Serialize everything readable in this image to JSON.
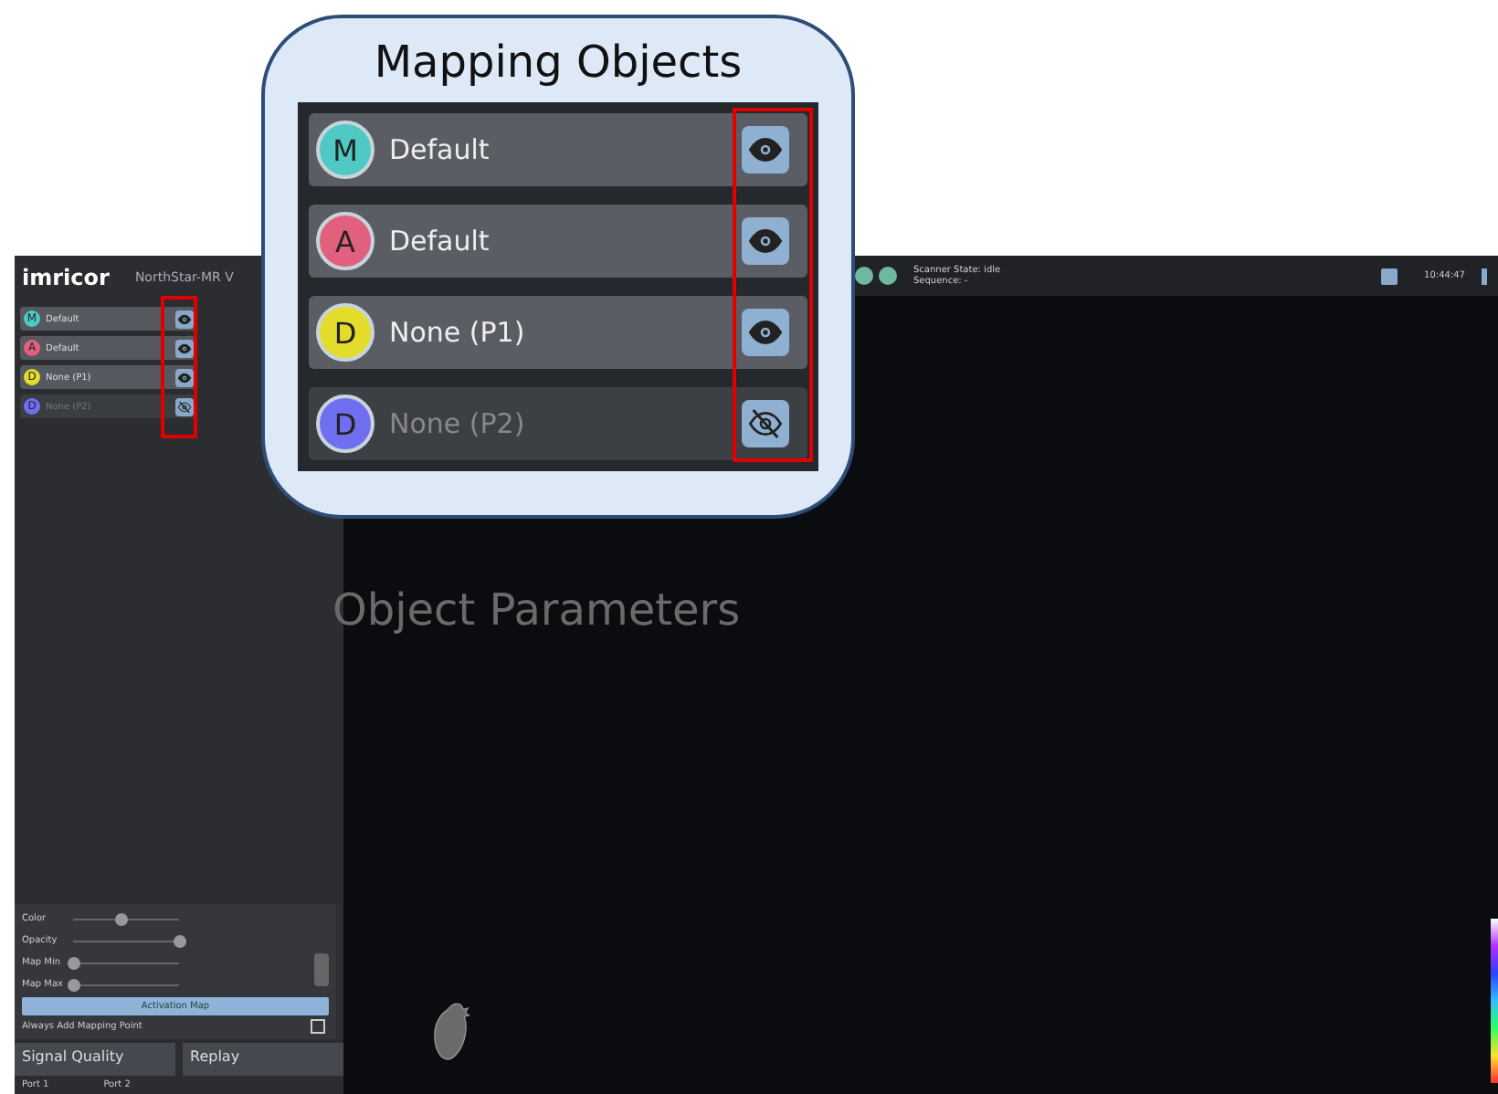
{
  "app": {
    "logo": "imricor",
    "product": "NorthStar-MR V"
  },
  "mapping_objects": [
    {
      "letter": "M",
      "color": "#4fc9c4",
      "label": "Default",
      "visible": true
    },
    {
      "letter": "A",
      "color": "#e0607e",
      "label": "Default",
      "visible": true
    },
    {
      "letter": "D",
      "color": "#e4dc2a",
      "label": "None (P1)",
      "visible": true
    },
    {
      "letter": "D",
      "color": "#6f6ff0",
      "label": "None (P2)",
      "visible": false
    }
  ],
  "object_parameters": {
    "sliders": [
      {
        "label": "Color",
        "level": 0.45
      },
      {
        "label": "Opacity",
        "level": 1.0
      },
      {
        "label": "Map Min",
        "level": 0.0
      },
      {
        "label": "Map Max",
        "level": 0.0
      }
    ],
    "button": "Activation Map",
    "option": {
      "label": "Always Add Mapping Point",
      "checked": false
    }
  },
  "bottom_tabs": [
    {
      "label": "Signal Quality"
    },
    {
      "label": "Replay"
    }
  ],
  "ports": [
    "Port 1",
    "Port 2"
  ],
  "status": {
    "state": "Scanner State: idle",
    "sequence": "Sequence: -",
    "time": "10:44:47"
  },
  "callout": {
    "title": "Mapping Objects",
    "objects": [
      {
        "letter": "M",
        "color": "#4fc9c4",
        "label": "Default",
        "visible": true
      },
      {
        "letter": "A",
        "color": "#e0607e",
        "label": "Default",
        "visible": true
      },
      {
        "letter": "D",
        "color": "#e4dc2a",
        "label": "None (P1)",
        "visible": true
      },
      {
        "letter": "D",
        "color": "#6f6ff0",
        "label": "None (P2)",
        "visible": false
      }
    ]
  },
  "caption": "Object Parameters"
}
